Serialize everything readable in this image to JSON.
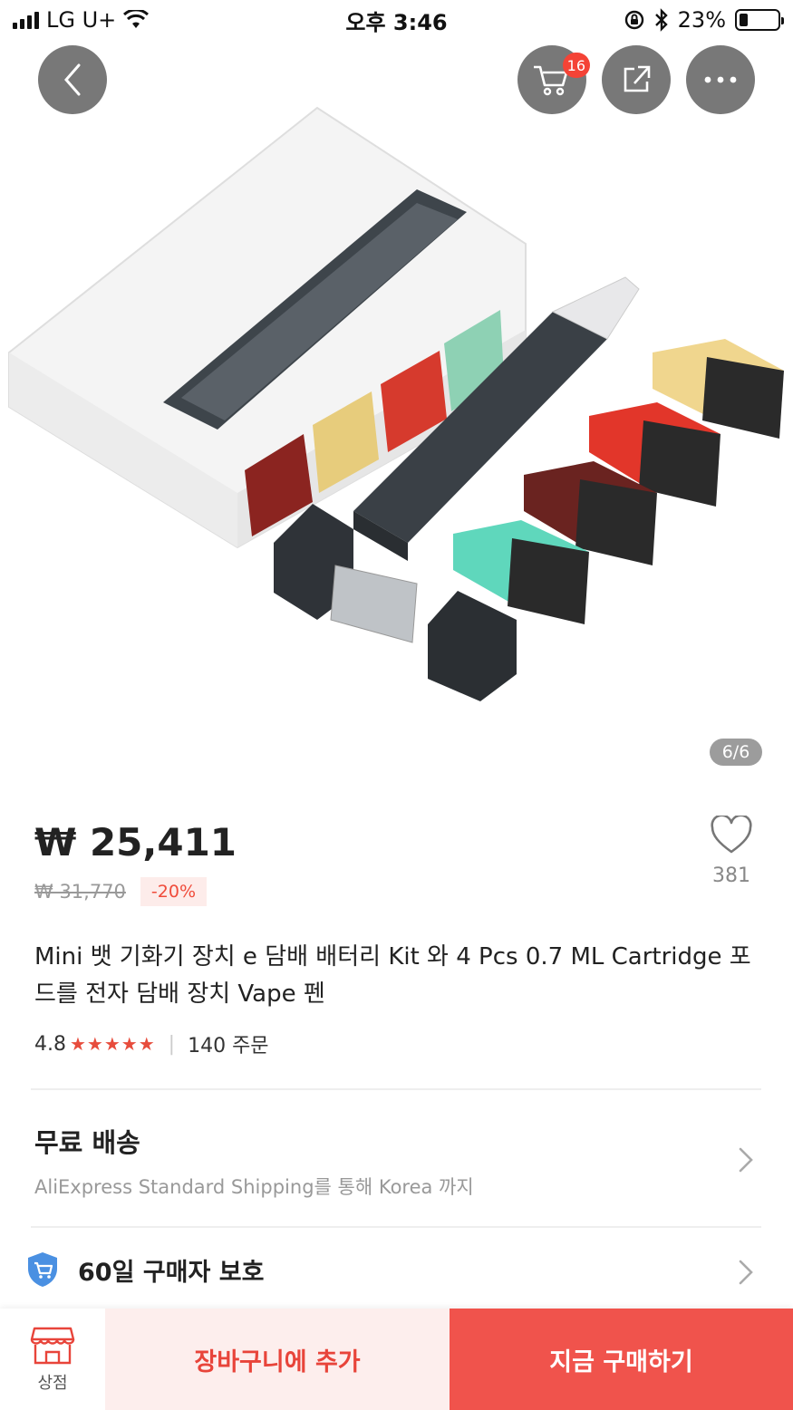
{
  "status_bar": {
    "carrier": "LG U+",
    "time": "오후 3:46",
    "battery_percent": "23%",
    "battery_level": 0.23
  },
  "header": {
    "cart_badge_count": "16"
  },
  "gallery": {
    "page_indicator": "6/6"
  },
  "price": {
    "current": "₩ 25,411",
    "original": "₩ 31,770",
    "discount": "-20%"
  },
  "wishlist": {
    "count": "381"
  },
  "product": {
    "title": "Mini 뱃 기화기 장치 e 담배 배터리 Kit 와 4 Pcs 0.7 ML Cartridge 포드를 전자 담배 장치 Vape 펜",
    "rating": "4.8",
    "stars": "★★★★★",
    "orders": "140 주문"
  },
  "shipping": {
    "title": "무료 배송",
    "subtitle": "AliExpress Standard Shipping를 통해 Korea 까지"
  },
  "protection": {
    "label": "60일 구매자 보호"
  },
  "bottom_bar": {
    "store_label": "상점",
    "add_to_cart": "장바구니에 추가",
    "buy_now": "지금 구매하기"
  },
  "colors": {
    "accent_red": "#f0534c",
    "light_red": "#fdeeed",
    "star_red": "#e74c3c",
    "badge_red": "#f44336"
  }
}
